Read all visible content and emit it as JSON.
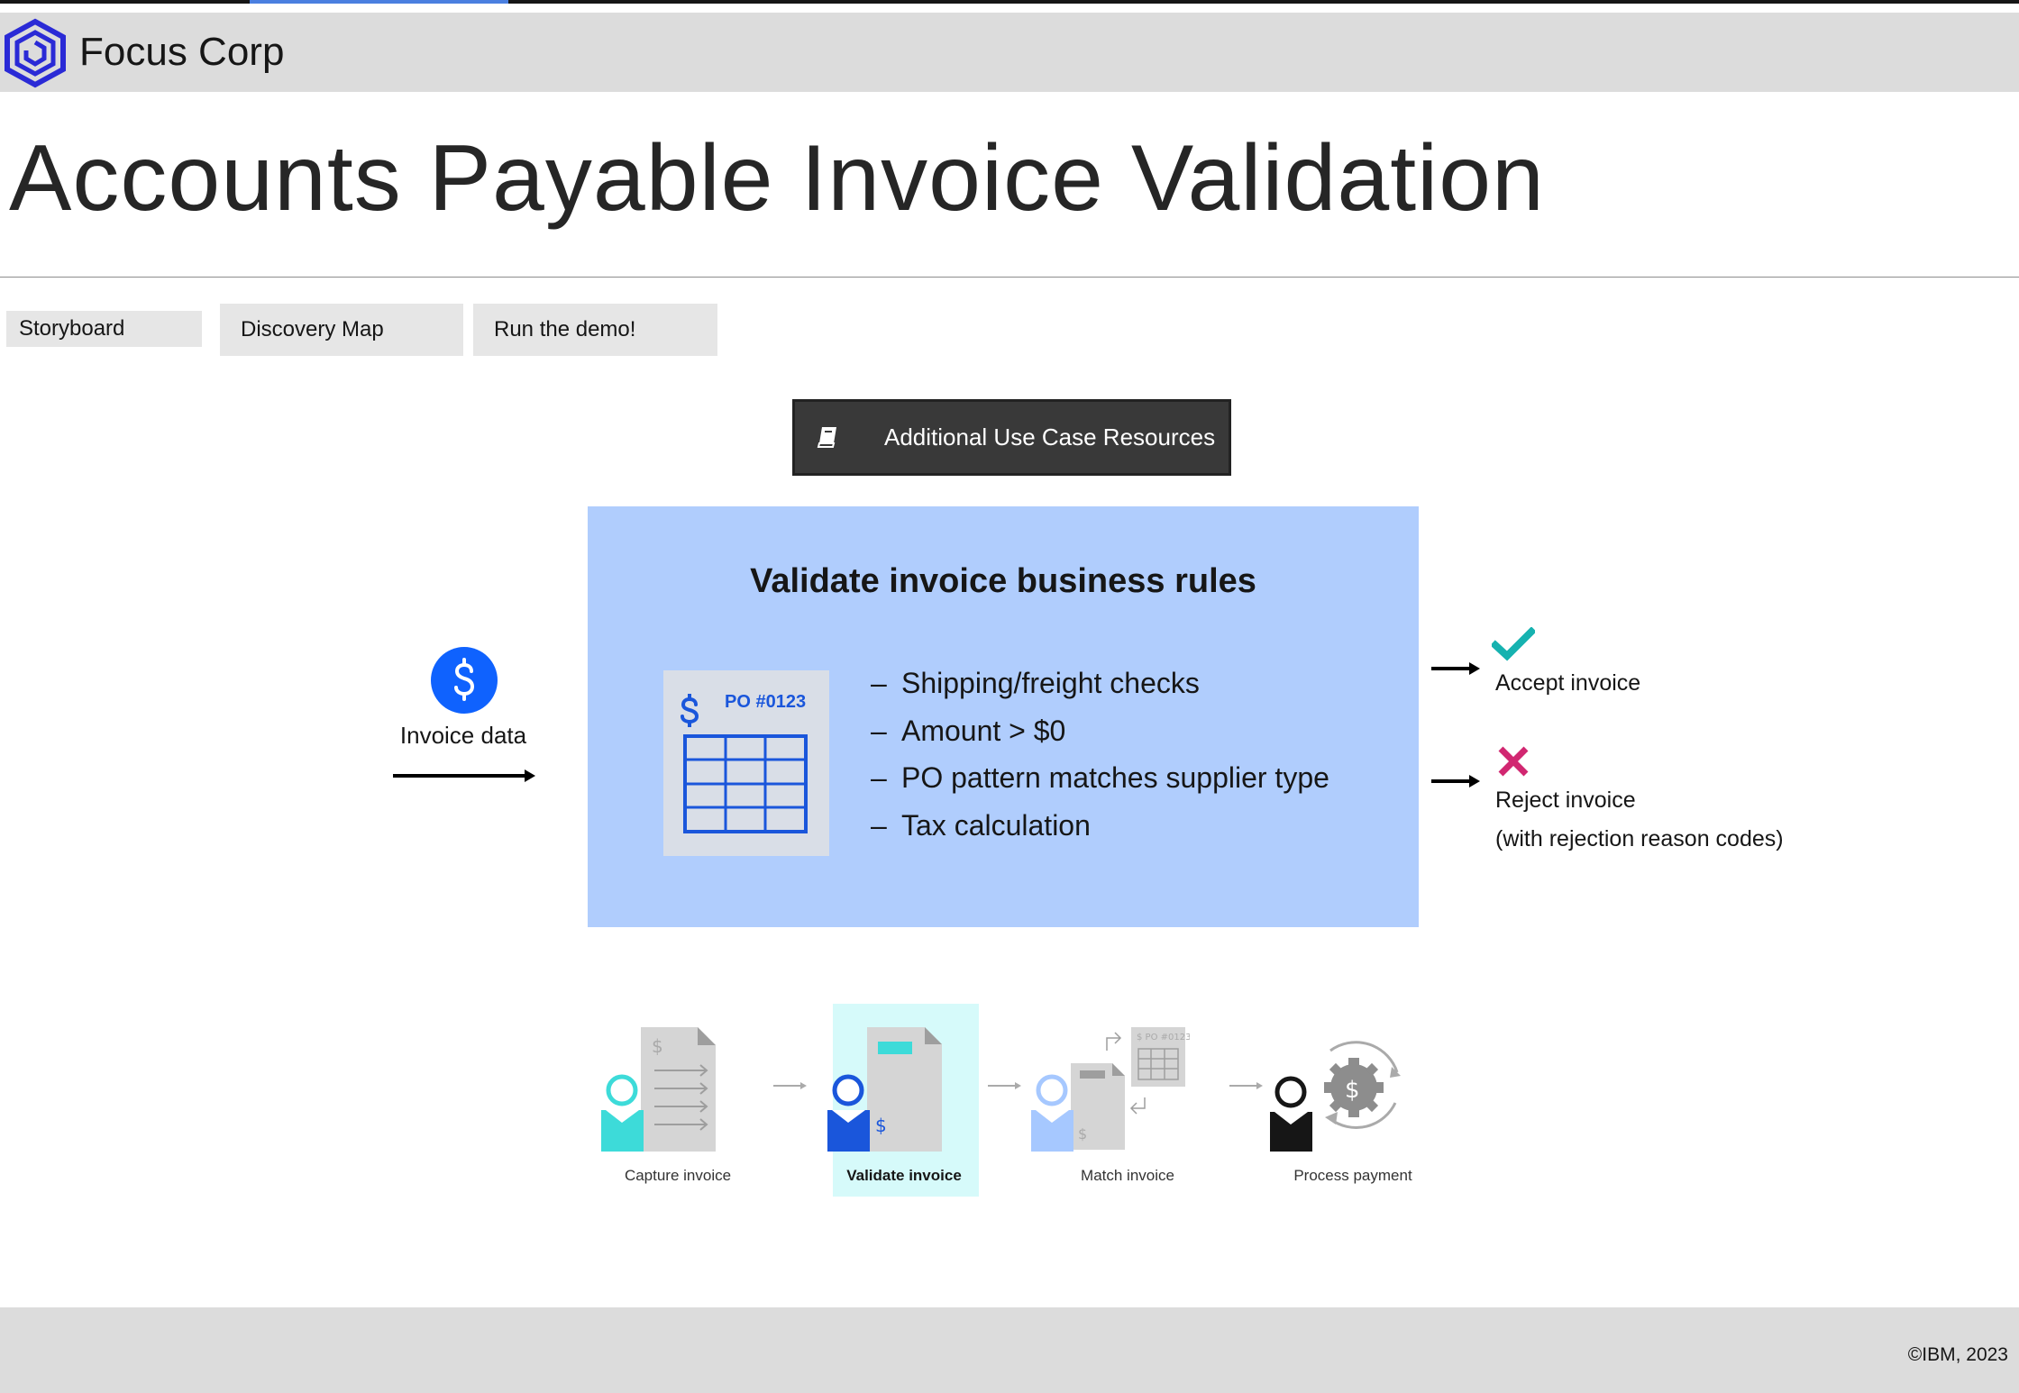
{
  "app": {
    "brand": "Focus Corp",
    "accent_color": "#4a7fe0",
    "logo_icon": "hexagon-logo-icon"
  },
  "page": {
    "title": "Accounts Payable Invoice Validation"
  },
  "tabs": [
    {
      "label": "Storyboard"
    },
    {
      "label": "Discovery Map"
    },
    {
      "label": "Run the demo!"
    }
  ],
  "resources_button": {
    "label": "Additional Use Case Resources",
    "icon": "book-icon"
  },
  "diagram": {
    "input_label": "Invoice data",
    "box_title": "Validate invoice business rules",
    "po_label": "PO #0123",
    "rules": [
      {
        "text": "Shipping/freight checks"
      },
      {
        "text": "Amount > $0"
      },
      {
        "text": "PO pattern matches supplier type"
      },
      {
        "text": "Tax calculation"
      }
    ],
    "accept_label": "Accept invoice",
    "reject_label": "Reject invoice",
    "reject_sub": "(with rejection reason codes)",
    "box_color": "#b0cdfd",
    "accept_color": "#16b2b0",
    "reject_color": "#d12771"
  },
  "process_steps": [
    {
      "label": "Capture invoice"
    },
    {
      "label": "Validate invoice"
    },
    {
      "label": "Match invoice"
    },
    {
      "label": "Process payment"
    }
  ],
  "footer": {
    "copyright": "©IBM, 2023"
  }
}
